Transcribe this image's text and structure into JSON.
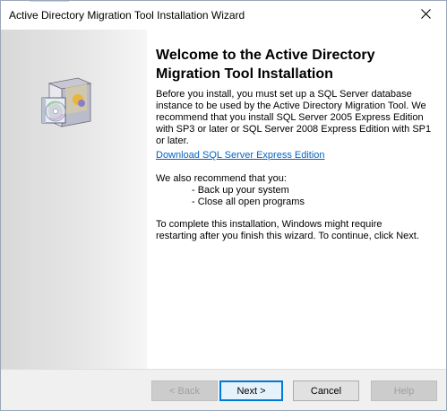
{
  "window": {
    "title": "Active Directory Migration Tool Installation Wizard"
  },
  "welcome": {
    "heading": "Welcome to the Active Directory Migration Tool Installation",
    "intro": "Before you install, you must set up a SQL Server database instance to be used by the Active Directory Migration Tool. We recommend that you install SQL Server 2005 Express Edition with SP3 or later or SQL Server 2008 Express Edition with SP1 or later.",
    "download_link": "Download SQL Server Express Edition",
    "recommend": "We also recommend that you:",
    "bullets": [
      "- Back up your system",
      "- Close all open programs"
    ],
    "closing": "To complete this installation, Windows might require restarting after you finish this wizard. To continue, click Next."
  },
  "buttons": {
    "back": "< Back",
    "next": "Next >",
    "cancel": "Cancel",
    "help": "Help"
  },
  "icons": {
    "close": "close-icon",
    "product": "software-box-cd-icon"
  },
  "colors": {
    "link": "#0563c1",
    "default_button_border": "#0078d7"
  }
}
